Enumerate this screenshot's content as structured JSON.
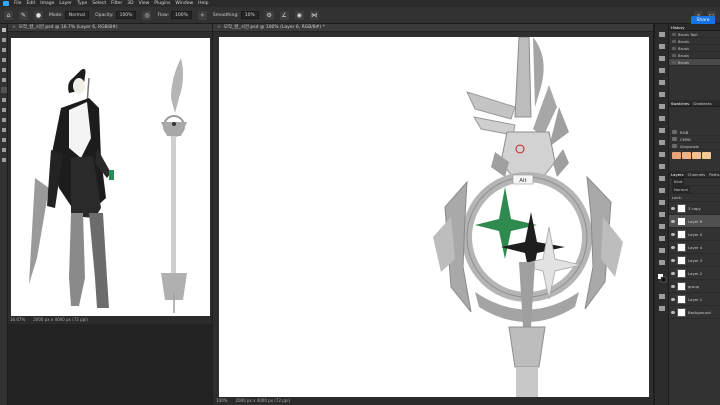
{
  "menu": [
    "File",
    "Edit",
    "Image",
    "Layer",
    "Type",
    "Select",
    "Filter",
    "3D",
    "View",
    "Plugins",
    "Window",
    "Help"
  ],
  "options": {
    "mode_label": "Mode:",
    "mode_value": "Normal",
    "opacity_label": "Opacity:",
    "opacity_value": "100%",
    "flow_label": "Flow:",
    "flow_value": "100%",
    "smoothing_label": "Smoothing:",
    "smoothing_value": "10%",
    "share_label": "Share"
  },
  "doc1": {
    "tab_title": "모작_칼_시안.psd @ 16.7% (Layer 6, RGB/8#)",
    "zoom": "16.67%",
    "dims": "2000 px x 4000 px (72 ppi)"
  },
  "doc2": {
    "tab_title": "모작_칼_시안.psd @ 100% (Layer 6, RGB/8#) *",
    "zoom": "100%",
    "dims": "2000 px x 4000 px (72 ppi)"
  },
  "history": {
    "tab": "History",
    "items": [
      "Brush Tool",
      "Brush",
      "Brush",
      "Brush",
      "Brush"
    ]
  },
  "swatches": {
    "tabs": [
      "Swatches",
      "Gradients"
    ],
    "groups": [
      "RGB",
      "CMYK",
      "Grayscale"
    ],
    "colors": [
      "#e8a47a",
      "#f0b486",
      "#f3c08f",
      "#f5c995"
    ]
  },
  "layers": {
    "tabs": [
      "Layers",
      "Channels",
      "Paths"
    ],
    "search": "Kind",
    "blend": "Normal",
    "lock_label": "Lock:",
    "items": [
      "Layer 6",
      "Layer 5",
      "Layer 4",
      "Layer 3",
      "Layer 2",
      "Layer 1",
      "Background"
    ],
    "text_item": "3 copy",
    "group_item": "group"
  },
  "tooltip": "Alt"
}
